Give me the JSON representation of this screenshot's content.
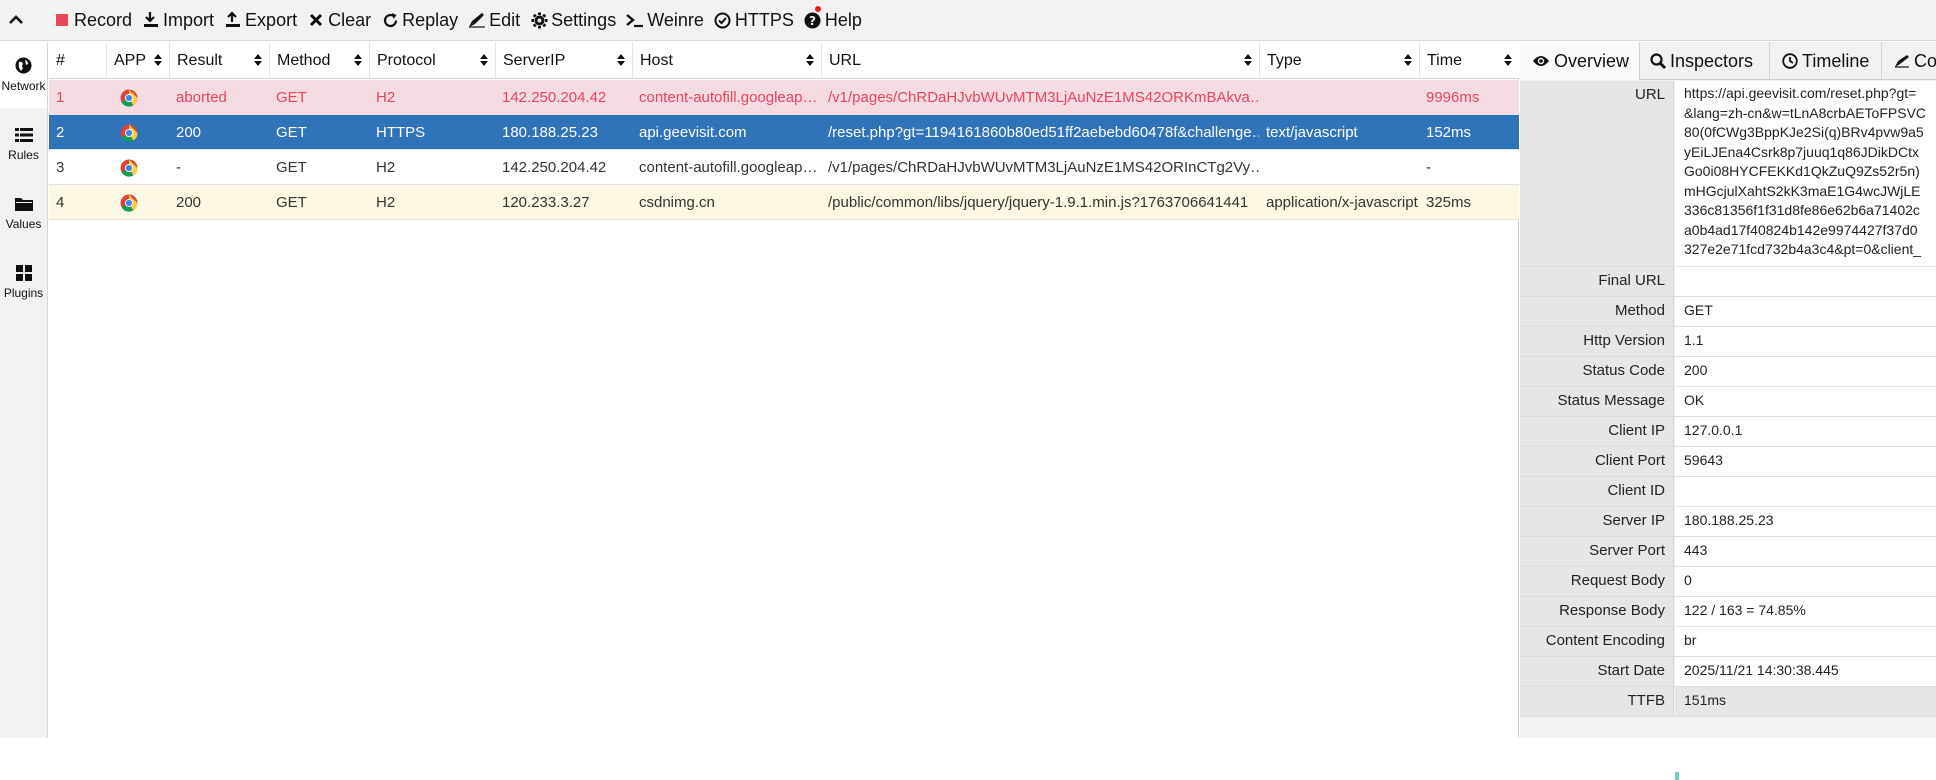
{
  "toolbar": {
    "buttons": [
      {
        "id": "record",
        "label": "Record",
        "icon": "record-square-icon",
        "color": "#e9475a"
      },
      {
        "id": "import",
        "label": "Import",
        "icon": "import-icon"
      },
      {
        "id": "export",
        "label": "Export",
        "icon": "export-icon"
      },
      {
        "id": "clear",
        "label": "Clear",
        "icon": "close-icon"
      },
      {
        "id": "replay",
        "label": "Replay",
        "icon": "replay-icon"
      },
      {
        "id": "edit",
        "label": "Edit",
        "icon": "edit-icon"
      },
      {
        "id": "settings",
        "label": "Settings",
        "icon": "gear-icon"
      },
      {
        "id": "weinre",
        "label": "Weinre",
        "icon": "terminal-icon"
      },
      {
        "id": "https",
        "label": "HTTPS",
        "icon": "check-circle-icon"
      },
      {
        "id": "help",
        "label": "Help",
        "icon": "question-circle-icon"
      }
    ]
  },
  "leftnav": {
    "items": [
      {
        "label": "Network",
        "icon": "globe-icon",
        "active": true
      },
      {
        "label": "Rules",
        "icon": "list-icon"
      },
      {
        "label": "Values",
        "icon": "folder-icon"
      },
      {
        "label": "Plugins",
        "icon": "grid-icon"
      }
    ]
  },
  "network": {
    "columns": [
      "#",
      "APP",
      "Result",
      "Method",
      "Protocol",
      "ServerIP",
      "Host",
      "URL",
      "Type",
      "Time"
    ],
    "rows": [
      {
        "num": "1",
        "app": "chrome-icon",
        "result": "aborted",
        "method": "GET",
        "protocol": "H2",
        "server_ip": "142.250.204.42",
        "host": "content-autofill.googleap…",
        "url": "/v1/pages/ChRDaHJvbWUvMTM3LjAuNzE1MS42ORKmBAkva…",
        "type": "",
        "time": "9996ms",
        "state": "err"
      },
      {
        "num": "2",
        "app": "chrome-icon",
        "result": "200",
        "method": "GET",
        "protocol": "HTTPS",
        "server_ip": "180.188.25.23",
        "host": "api.geevisit.com",
        "url": "/reset.php?gt=1194161860b80ed51ff2aebebd60478f&challenge…",
        "type": "text/javascript",
        "time": "152ms",
        "state": "sel"
      },
      {
        "num": "3",
        "app": "chrome-icon",
        "result": "-",
        "method": "GET",
        "protocol": "H2",
        "server_ip": "142.250.204.42",
        "host": "content-autofill.googleap…",
        "url": "/v1/pages/ChRDaHJvbWUvMTM3LjAuNzE1MS42ORInCTg2Vy…",
        "type": "",
        "time": "-",
        "state": "plain"
      },
      {
        "num": "4",
        "app": "chrome-icon",
        "result": "200",
        "method": "GET",
        "protocol": "H2",
        "server_ip": "120.233.3.27",
        "host": "csdnimg.cn",
        "url": "/public/common/libs/jquery/jquery-1.9.1.min.js?1763706641441",
        "type": "application/x-javascript",
        "time": "325ms",
        "state": "warn"
      }
    ]
  },
  "inspector": {
    "tabs": [
      {
        "label": "Overview",
        "icon": "eye-icon",
        "active": true
      },
      {
        "label": "Inspectors",
        "icon": "search-icon"
      },
      {
        "label": "Timeline",
        "icon": "clock-icon"
      },
      {
        "label": "Co",
        "icon": "compose-icon"
      }
    ],
    "url_lines": [
      "https://api.geevisit.com/reset.php?gt=",
      "&lang=zh-cn&w=tLnA8crbAEToFPSVC",
      "80(0fCWg3BppKJe2Si(q)BRv4pvw9a5",
      "yEiLJEna4Csrk8p7juuq1q86JDikDCtx",
      "Go0i08HYCFEKKd1QkZuQ9Zs52r5n)",
      "mHGcjulXahtS2kK3maE1G4wcJWjLE",
      "336c81356f1f31d8fe86e62b6a71402c",
      "a0b4ad17f40824b142e9974427f37d0",
      "327e2e71fcd732b4a3c4&pt=0&client_"
    ],
    "url_label": "URL",
    "fields": [
      {
        "label": "Final URL",
        "value": ""
      },
      {
        "label": "Method",
        "value": "GET"
      },
      {
        "label": "Http Version",
        "value": "1.1"
      },
      {
        "label": "Status Code",
        "value": "200"
      },
      {
        "label": "Status Message",
        "value": "OK"
      },
      {
        "label": "Client IP",
        "value": "127.0.0.1"
      },
      {
        "label": "Client Port",
        "value": "59643"
      },
      {
        "label": "Client ID",
        "value": ""
      },
      {
        "label": "Server IP",
        "value": "180.188.25.23"
      },
      {
        "label": "Server Port",
        "value": "443"
      },
      {
        "label": "Request Body",
        "value": "0"
      },
      {
        "label": "Response Body",
        "value": "122 / 163 = 74.85%"
      },
      {
        "label": "Content Encoding",
        "value": "br"
      },
      {
        "label": "Start Date",
        "value": "2025/11/21 14:30:38.445"
      },
      {
        "label": "TTFB",
        "value": "151ms"
      }
    ]
  }
}
